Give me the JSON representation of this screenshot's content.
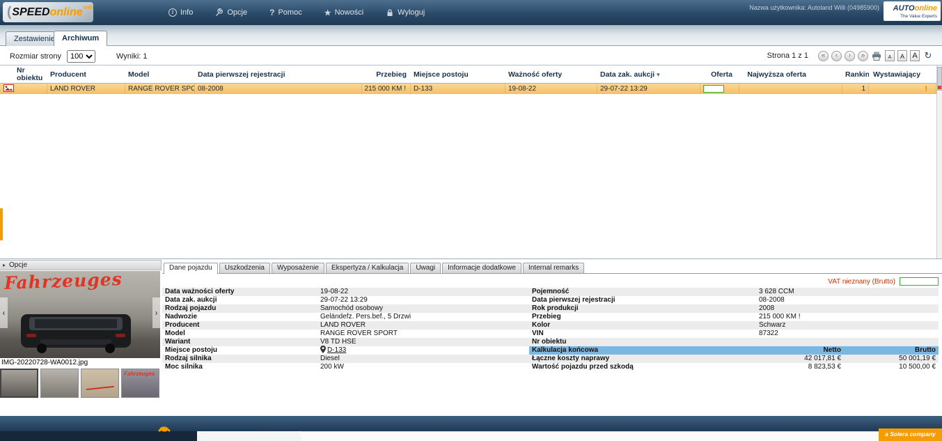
{
  "header": {
    "logo_paren": "(",
    "logo_speed": "SPEED",
    "logo_online": "online",
    "logo_web": "web",
    "menu": [
      {
        "label": "Info"
      },
      {
        "label": "Opcje"
      },
      {
        "label": "Pomoc"
      },
      {
        "label": "Nowości"
      },
      {
        "label": "Wyloguj"
      }
    ],
    "user_label": "Nazwa użytkownika: Autoland Willi (04985900)",
    "brand_auto": "AUTO",
    "brand_online": "online",
    "brand_tagline": "The Value Experts"
  },
  "icons": {
    "info": "i",
    "pomoc": "?",
    "nowosci": "★",
    "refresh": "↻",
    "sort_desc": "▾",
    "nav_first": "«",
    "nav_prev": "‹",
    "nav_next": "›",
    "nav_last": "»",
    "expander": "▸",
    "photo_prev": "‹",
    "photo_next": "›",
    "warning": "!"
  },
  "main_tabs": {
    "zestawienie": "Zestawienie",
    "archiwum": "Archiwum"
  },
  "toolbar": {
    "page_size_label": "Rozmiar strony",
    "page_size_value": "100",
    "results_label": "Wyniki: 1",
    "page_label": "Strona 1 z 1",
    "font_small": "A",
    "font_medium": "A",
    "font_large": "A"
  },
  "table": {
    "columns": {
      "nr_line1": "Nr",
      "nr_line2": "obiektu",
      "producent": "Producent",
      "model": "Model",
      "rejestracja": "Data pierwszej rejestracji",
      "przebieg": "Przebieg",
      "miejsce": "Miejsce postoju",
      "waznosc": "Ważność oferty",
      "data_zak": "Data zak. aukcji",
      "oferta": "Oferta",
      "najwyzsza": "Najwyższa oferta",
      "ranking": "Ranking",
      "wystawiajacy": "Wystawiający"
    },
    "row": {
      "producent": "LAND ROVER",
      "model": "RANGE ROVER SPOR...",
      "rejestracja": "08-2008",
      "przebieg": "215 000 KM !",
      "miejsce": "D-133",
      "waznosc": "19-08-22",
      "data_zak": "29-07-22 13:29",
      "ranking": "1"
    }
  },
  "detail": {
    "opcje_label": "Opcje",
    "photo_overlay": "Fahrzeuges",
    "photo_caption": "IMG-20220728-WA0012.jpg",
    "tabs": [
      "Dane pojazdu",
      "Uszkodzenia",
      "Wyposażenie",
      "Ekspertyza / Kalkulacja",
      "Uwagi",
      "Informacje dodatkowe",
      "Internal remarks"
    ],
    "vat_label": "VAT nieznany (Brutto)",
    "left_fields": [
      {
        "label": "Data ważności oferty",
        "value": "19-08-22"
      },
      {
        "label": "Data zak. aukcji",
        "value": "29-07-22 13:29"
      },
      {
        "label": "Rodzaj pojazdu",
        "value": "Samochód osobowy"
      },
      {
        "label": "Nadwozie",
        "value": "Geländefz. Pers.bef., 5 Drzwi"
      },
      {
        "label": "Producent",
        "value": "LAND ROVER"
      },
      {
        "label": "Model",
        "value": "RANGE ROVER SPORT"
      },
      {
        "label": "Wariant",
        "value": "V8 TD HSE"
      },
      {
        "label": "Miejsce postoju",
        "value": "D-133"
      },
      {
        "label": "Rodzaj silnika",
        "value": "Diesel"
      },
      {
        "label": "Moc silnika",
        "value": "200 kW"
      }
    ],
    "right_fields": [
      {
        "label": "Pojemność",
        "value": "3 628 CCM"
      },
      {
        "label": "Data pierwszej rejestracji",
        "value": "08-2008"
      },
      {
        "label": "Rok produkcji",
        "value": "2008"
      },
      {
        "label": "Przebieg",
        "value": "215 000 KM !"
      },
      {
        "label": "Kolor",
        "value": "Schwarz"
      },
      {
        "label": "VIN",
        "value": "87322"
      },
      {
        "label": "Nr obiektu",
        "value": ""
      }
    ],
    "kalkulacja": {
      "title": "Kalkulacja końcowa",
      "netto": "Netto",
      "brutto": "Brutto",
      "rows": [
        {
          "label": "Łączne koszty naprawy",
          "netto": "42 017,81 €",
          "brutto": "50 001,19 €"
        },
        {
          "label": "Wartość pojazdu przed szkodą",
          "netto": "8 823,53 €",
          "brutto": "10 500,00 €"
        }
      ]
    }
  },
  "footer": {
    "solera_label": "a Solera company"
  }
}
